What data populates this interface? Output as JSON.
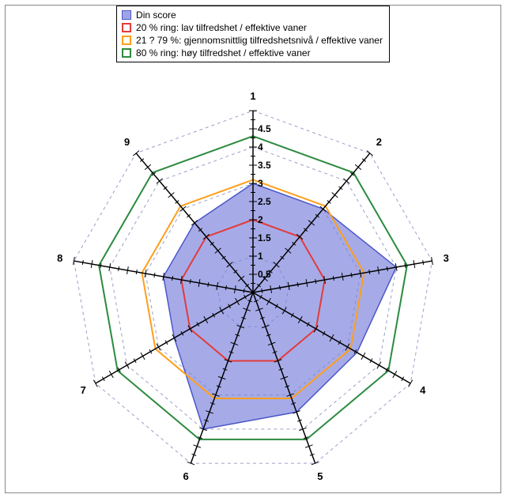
{
  "legend": {
    "din_score": {
      "label": "Din score",
      "fill": "#8e94e6",
      "fill_alpha": "rgba(118,126,220,0.65)",
      "stroke": "#4b57c9"
    },
    "low": {
      "label": "20 % ring: lav tilfredshet / effektive vaner",
      "stroke": "#e23b3b",
      "fill": "none"
    },
    "mid": {
      "label": "21 ? 79 %: gjennomsnittlig tilfredshetsnivå / effektive vaner",
      "stroke": "#ff9e1b",
      "fill": "none"
    },
    "high": {
      "label": "80 % ring: høy tilfredshet / effektive vaner",
      "stroke": "#2b8a3e",
      "fill": "none"
    }
  },
  "chart_data": {
    "type": "radar",
    "axes": [
      "1",
      "2",
      "3",
      "4",
      "5",
      "6",
      "7",
      "8",
      "9"
    ],
    "scale": {
      "min": 0,
      "max": 5,
      "tick_labels": [
        "0.5",
        "1",
        "1.5",
        "2",
        "2.5",
        "3",
        "3.5",
        "4",
        "4.5"
      ]
    },
    "grid_rings": [
      1,
      2,
      3,
      4,
      5
    ],
    "series": [
      {
        "name": "Din score",
        "kind": "filled",
        "values": [
          3.0,
          3.0,
          4.0,
          3.3,
          3.5,
          4.0,
          2.5,
          2.5,
          2.5
        ]
      },
      {
        "name": "20 % ring",
        "kind": "line",
        "values": [
          2.0,
          2.0,
          2.0,
          2.0,
          2.0,
          2.0,
          2.0,
          2.0,
          2.0
        ]
      },
      {
        "name": "21 ? 79 %",
        "kind": "line",
        "values": [
          3.1,
          3.1,
          3.1,
          3.1,
          3.1,
          3.1,
          3.1,
          3.1,
          3.1
        ]
      },
      {
        "name": "80 % ring",
        "kind": "line",
        "values": [
          4.3,
          4.3,
          4.3,
          4.3,
          4.3,
          4.3,
          4.3,
          4.3,
          4.3
        ]
      }
    ]
  }
}
